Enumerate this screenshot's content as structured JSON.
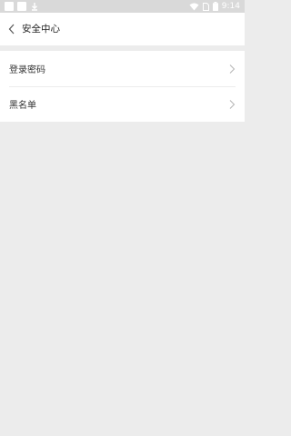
{
  "status_bar": {
    "time": "9:14",
    "icons": [
      "notification-square-icon",
      "notification-square-icon",
      "download-icon",
      "wifi-icon",
      "sim-icon",
      "battery-icon"
    ]
  },
  "header": {
    "title": "安全中心",
    "back_icon": "back-chevron-icon"
  },
  "menu": {
    "items": [
      {
        "label": "登录密码",
        "icon": "chevron-right-icon"
      },
      {
        "label": "黑名单",
        "icon": "chevron-right-icon"
      }
    ]
  },
  "colors": {
    "background": "#ececec",
    "status_bar": "#d9d9d9",
    "surface": "#ffffff",
    "text": "#222222",
    "chevron": "#b5b5b5"
  }
}
